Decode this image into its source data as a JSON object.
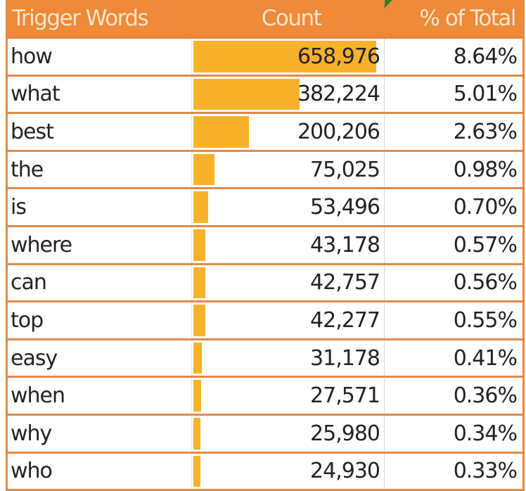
{
  "table": {
    "headers": {
      "word": "Trigger Words",
      "count": "Count",
      "pct": "% of Total"
    },
    "colors": {
      "header_bg": "#ee8a38",
      "header_text": "#fbe3cc",
      "border": "#e08a4a",
      "data_bar": "#f8b22a",
      "marker": "#2f7d1f"
    },
    "rows": [
      {
        "word": "how",
        "count": "658,976",
        "pct": "8.64%"
      },
      {
        "word": "what",
        "count": "382,224",
        "pct": "5.01%"
      },
      {
        "word": "best",
        "count": "200,206",
        "pct": "2.63%"
      },
      {
        "word": "the",
        "count": "75,025",
        "pct": "0.98%"
      },
      {
        "word": "is",
        "count": "53,496",
        "pct": "0.70%"
      },
      {
        "word": "where",
        "count": "43,178",
        "pct": "0.57%"
      },
      {
        "word": "can",
        "count": "42,757",
        "pct": "0.56%"
      },
      {
        "word": "top",
        "count": "42,277",
        "pct": "0.55%"
      },
      {
        "word": "easy",
        "count": "31,178",
        "pct": "0.41%"
      },
      {
        "word": "when",
        "count": "27,571",
        "pct": "0.36%"
      },
      {
        "word": "why",
        "count": "25,980",
        "pct": "0.34%"
      },
      {
        "word": "who",
        "count": "24,930",
        "pct": "0.33%"
      }
    ]
  },
  "chart_data": {
    "type": "table",
    "title": "",
    "columns": [
      "Trigger Words",
      "Count",
      "% of Total"
    ],
    "categories": [
      "how",
      "what",
      "best",
      "the",
      "is",
      "where",
      "can",
      "top",
      "easy",
      "when",
      "why",
      "who"
    ],
    "values": [
      658976,
      382224,
      200206,
      75025,
      53496,
      43178,
      42757,
      42277,
      31178,
      27571,
      25980,
      24930
    ],
    "percent_of_total": [
      8.64,
      5.01,
      2.63,
      0.98,
      0.7,
      0.57,
      0.56,
      0.55,
      0.41,
      0.36,
      0.34,
      0.33
    ],
    "data_bars": {
      "column": "Count",
      "min": 0,
      "max": 658976
    }
  }
}
